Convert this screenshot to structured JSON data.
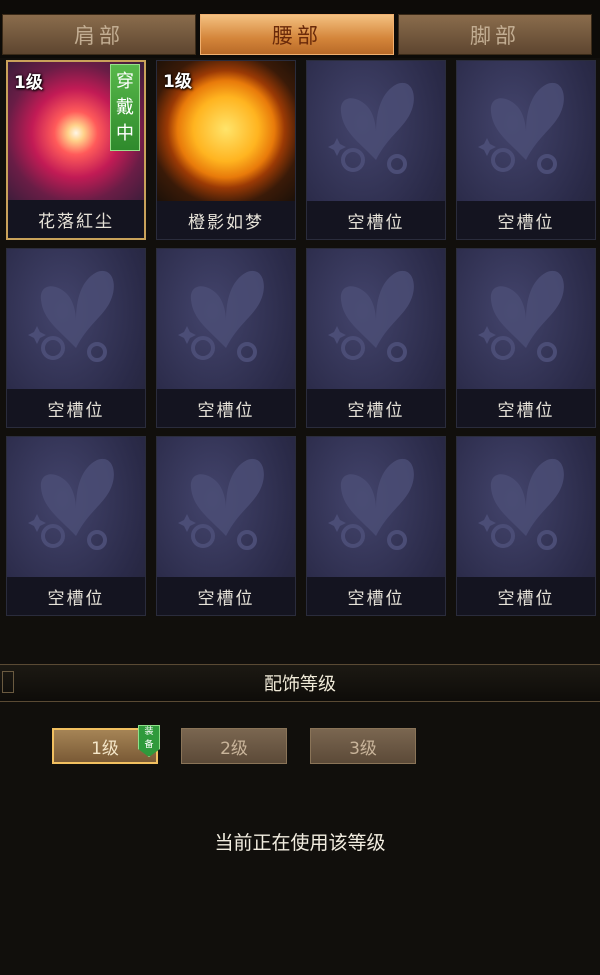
{
  "tabs": [
    {
      "label": "肩部",
      "active": false
    },
    {
      "label": "腰部",
      "active": true
    },
    {
      "label": "脚部",
      "active": false
    }
  ],
  "slots": [
    {
      "name": "花落紅尘",
      "level": "1级",
      "badge": [
        "穿",
        "戴",
        "中"
      ],
      "icon": "red-burst-icon"
    },
    {
      "name": "橙影如梦",
      "level": "1级",
      "icon": "golden-sun-icon"
    },
    {
      "name": "空槽位",
      "icon": "butterfly-placeholder-icon"
    },
    {
      "name": "空槽位",
      "icon": "butterfly-placeholder-icon"
    },
    {
      "name": "空槽位",
      "icon": "butterfly-placeholder-icon"
    },
    {
      "name": "空槽位",
      "icon": "butterfly-placeholder-icon"
    },
    {
      "name": "空槽位",
      "icon": "butterfly-placeholder-icon"
    },
    {
      "name": "空槽位",
      "icon": "butterfly-placeholder-icon"
    },
    {
      "name": "空槽位",
      "icon": "butterfly-placeholder-icon"
    },
    {
      "name": "空槽位",
      "icon": "butterfly-placeholder-icon"
    },
    {
      "name": "空槽位",
      "icon": "butterfly-placeholder-icon"
    },
    {
      "name": "空槽位",
      "icon": "butterfly-placeholder-icon"
    }
  ],
  "section": {
    "title": "配饰等级"
  },
  "levels": [
    {
      "label": "1级",
      "active": true,
      "tag": [
        "装",
        "备"
      ]
    },
    {
      "label": "2级",
      "active": false
    },
    {
      "label": "3级",
      "active": false
    }
  ],
  "status": "当前正在使用该等级",
  "colors": {
    "accent": "#d4853a",
    "badge_green": "#2f8a2c",
    "selected_border": "#c9a25a"
  }
}
